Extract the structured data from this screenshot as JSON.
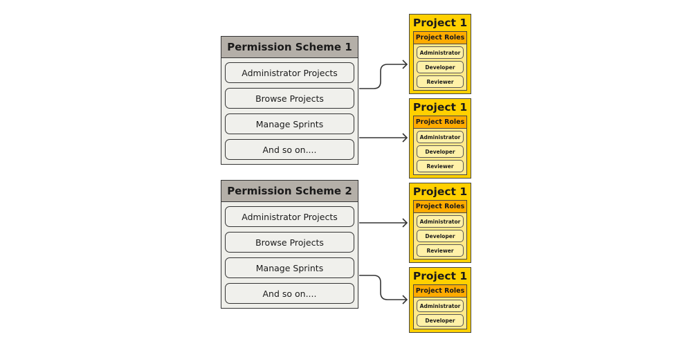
{
  "schemes": [
    {
      "title": "Permission Scheme 1",
      "permissions": [
        "Administrator Projects",
        "Browse Projects",
        "Manage Sprints",
        "And so on...."
      ]
    },
    {
      "title": "Permission Scheme 2",
      "permissions": [
        "Administrator Projects",
        "Browse Projects",
        "Manage Sprints",
        "And so on...."
      ]
    }
  ],
  "projects": [
    {
      "title": "Project 1",
      "roles_label": "Project Roles",
      "roles": [
        "Administrator",
        "Developer",
        "Reviewer"
      ]
    },
    {
      "title": "Project 1",
      "roles_label": "Project Roles",
      "roles": [
        "Administrator",
        "Developer",
        "Reviewer"
      ]
    },
    {
      "title": "Project 1",
      "roles_label": "Project Roles",
      "roles": [
        "Administrator",
        "Developer",
        "Reviewer"
      ]
    },
    {
      "title": "Project 1",
      "roles_label": "Project Roles",
      "roles": [
        "Administrator",
        "Developer"
      ]
    }
  ],
  "colors": {
    "scheme_header": "#b4afa8",
    "project_bg": "#ffd000",
    "roles_header": "#ffab00",
    "roles_bg": "#ffe98a"
  }
}
